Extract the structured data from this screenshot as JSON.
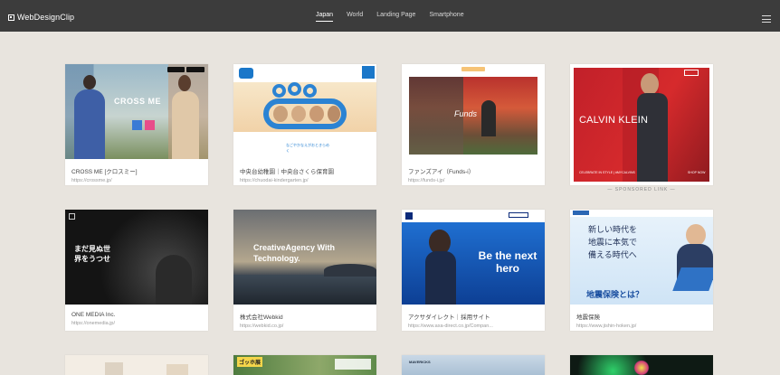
{
  "header": {
    "logo": "WebDesignClip",
    "nav": [
      "Japan",
      "World",
      "Landing Page",
      "Smartphone"
    ],
    "active_nav": "Japan"
  },
  "cards": [
    {
      "title": "CROSS ME [クロスミー]",
      "url": "https://crossme.jp/",
      "thumb_text": "CROSS ME"
    },
    {
      "title": "中央台幼稚園｜中央台さくら保育園",
      "url": "https://chuodai-kindergarten.jp/",
      "thumb_text": "なごやかなえがおときらめく"
    },
    {
      "title": "ファンズアイ（Funds-i）",
      "url": "https://funds-i.jp/",
      "thumb_text": "Funds"
    },
    {
      "title": "ONE MEDIA Inc.",
      "url": "https://onemedia.jp/",
      "thumb_text": "まだ見ぬ世界をうつせ"
    },
    {
      "title": "株式会社Webkid",
      "url": "https://webkid.co.jp/",
      "thumb_text": "CreativeAgency With Technology."
    },
    {
      "title": "アクサダイレクト｜採用サイト",
      "url": "https://www.axa-direct.co.jp/Compan...",
      "thumb_text": "Be the next hero"
    },
    {
      "title": "地震保険",
      "url": "https://www.jishin-hoken.jp/",
      "thumb_text": "新しい時代を地震に本気で備える時代へ",
      "thumb_sub": "地震保険とは？"
    }
  ],
  "ad": {
    "brand": "CALVIN KLEIN",
    "caption": "CELEBRATE IN STYLE | #MYCALVINS",
    "cta": "SHOP NOW",
    "label": "— SPONSORED LINK —"
  },
  "bottom_thumb_text": {
    "c2": "ゴッホ展",
    "c3": "MAVERICKS"
  }
}
